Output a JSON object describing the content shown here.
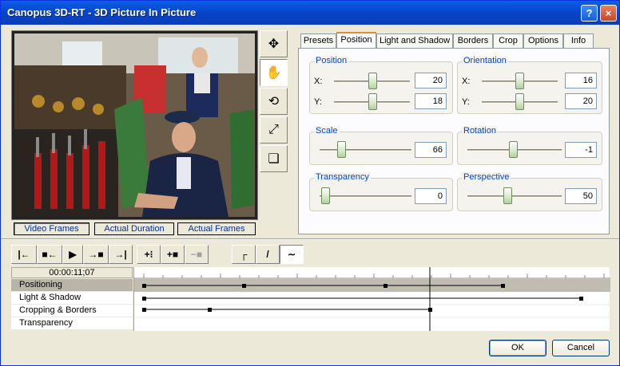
{
  "window": {
    "title": "Canopus 3D-RT - 3D Picture In Picture",
    "help_label": "?",
    "close_label": "×"
  },
  "tool_column": [
    {
      "name": "move-tool",
      "glyph": "✥"
    },
    {
      "name": "hand-tool",
      "glyph": "✋"
    },
    {
      "name": "rotate-tool",
      "glyph": "⟲"
    },
    {
      "name": "scale-tool",
      "glyph": "⤢"
    },
    {
      "name": "shadow-tool",
      "glyph": "❏"
    }
  ],
  "frame_buttons": {
    "video_frames": "Video Frames",
    "actual_duration": "Actual Duration",
    "actual_frames": "Actual Frames"
  },
  "tabs": [
    "Presets",
    "Position",
    "Light and Shadow",
    "Borders",
    "Crop",
    "Options",
    "Info"
  ],
  "active_tab": "Position",
  "position": {
    "label": "Position",
    "x_label": "X:",
    "y_label": "Y:",
    "x_value": "20",
    "y_value": "18"
  },
  "orientation": {
    "label": "Orientation",
    "x_label": "X:",
    "y_label": "Y:",
    "x_value": "16",
    "y_value": "20"
  },
  "scale": {
    "label": "Scale",
    "value": "66"
  },
  "rotation": {
    "label": "Rotation",
    "value": "-1"
  },
  "transparency": {
    "label": "Transparency",
    "value": "0"
  },
  "perspective": {
    "label": "Perspective",
    "value": "50"
  },
  "timeline": {
    "timecode": "00:00:11;07",
    "tracks": [
      "Positioning",
      "Light & Shadow",
      "Cropping & Borders",
      "Transparency"
    ]
  },
  "buttons": {
    "ok": "OK",
    "cancel": "Cancel"
  },
  "colors": {
    "title_bar": "#0a5fe8",
    "group_label": "#0046d5",
    "active_tab_accent": "#e68b2c"
  }
}
